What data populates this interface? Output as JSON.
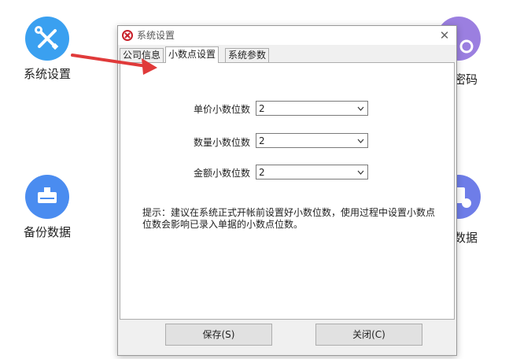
{
  "desktop": {
    "icons": [
      {
        "label": "系统设置",
        "color": "#3aa0f0"
      },
      {
        "label": "备份数据",
        "color": "#4a8cf0"
      },
      {
        "label": "密码",
        "color": "#9b7fe0"
      },
      {
        "label": "数据",
        "color": "#6e7de8"
      }
    ]
  },
  "dialog": {
    "title": "系统设置",
    "close_symbol": "✕",
    "tabs": [
      {
        "label": "公司信息",
        "active": false
      },
      {
        "label": "小数点设置",
        "active": true
      },
      {
        "label": "系统参数",
        "active": false
      }
    ],
    "fields": [
      {
        "label": "单价小数位数",
        "value": "2"
      },
      {
        "label": "数量小数位数",
        "value": "2"
      },
      {
        "label": "金额小数位数",
        "value": "2"
      }
    ],
    "hint": "提示：建议在系统正式开帐前设置好小数位数，使用过程中设置小数点位数会影响已录入单据的小数点位数。",
    "save_label": "保存(S)",
    "close_label": "关闭(C)"
  },
  "colors": {
    "arrow": "#e03a3a",
    "title_icon": "#c8202a"
  }
}
